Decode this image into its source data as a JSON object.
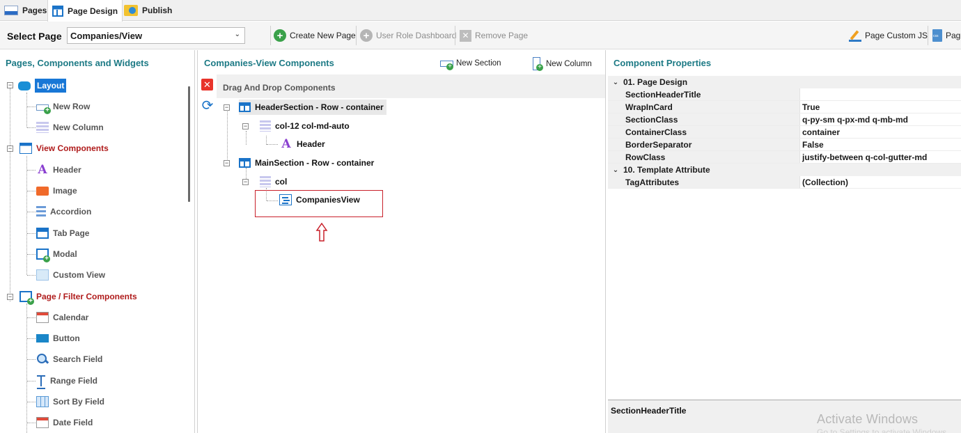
{
  "tabs": [
    {
      "label": "Pages",
      "icon": "pages-icon"
    },
    {
      "label": "Page Design",
      "icon": "page-design-icon",
      "active": true
    },
    {
      "label": "Publish",
      "icon": "publish-icon"
    }
  ],
  "toolbar": {
    "select_page_label": "Select Page",
    "select_page_value": "Companies/View",
    "create_new_page": "Create New Page",
    "user_role_dashboard": "User Role Dashboard",
    "remove_page": "Remove Page",
    "page_custom_js": "Page Custom JS",
    "page_custom_css_truncated": "Pag"
  },
  "left_panel": {
    "title": "Pages, Components and Widgets",
    "layout": {
      "label": "Layout",
      "items": [
        "New Row",
        "New Column"
      ]
    },
    "view_components": {
      "label": "View Components",
      "items": [
        "Header",
        "Image",
        "Accordion",
        "Tab Page",
        "Modal",
        "Custom View"
      ]
    },
    "page_filter_components": {
      "label": "Page / Filter Components",
      "items": [
        "Calendar",
        "Button",
        "Search Field",
        "Range Field",
        "Sort By Field",
        "Date Field"
      ]
    }
  },
  "middle_panel": {
    "title": "Companies-View Components",
    "new_section": "New Section",
    "new_column": "New Column",
    "drag_drop_title": "Drag And Drop Components",
    "tree": {
      "header_section": "HeaderSection - Row - container",
      "header_col": "col-12 col-md-auto",
      "header_item": "Header",
      "main_section": "MainSection - Row - container",
      "main_col": "col",
      "main_item": "CompaniesView"
    }
  },
  "right_panel": {
    "title": "Component Properties",
    "groups": [
      {
        "label": "01. Page Design",
        "rows": [
          {
            "key": "SectionHeaderTitle",
            "value": ""
          },
          {
            "key": "WrapInCard",
            "value": "True"
          },
          {
            "key": "SectionClass",
            "value": "q-py-sm q-px-md q-mb-md"
          },
          {
            "key": "ContainerClass",
            "value": "container"
          },
          {
            "key": "BorderSeparator",
            "value": "False"
          },
          {
            "key": "RowClass",
            "value": "justify-between q-col-gutter-md"
          }
        ]
      },
      {
        "label": "10. Template Attribute",
        "rows": [
          {
            "key": "TagAttributes",
            "value": "(Collection)"
          }
        ]
      }
    ],
    "description_title": "SectionHeaderTitle"
  },
  "watermark": {
    "title": "Activate Windows",
    "subtitle": "Go to Settings to activate Windows."
  },
  "colors": {
    "panel_title": "#1d7a85",
    "category_red": "#b01c1c",
    "selection_blue": "#1877d6",
    "highlight_box": "#c8202a"
  }
}
